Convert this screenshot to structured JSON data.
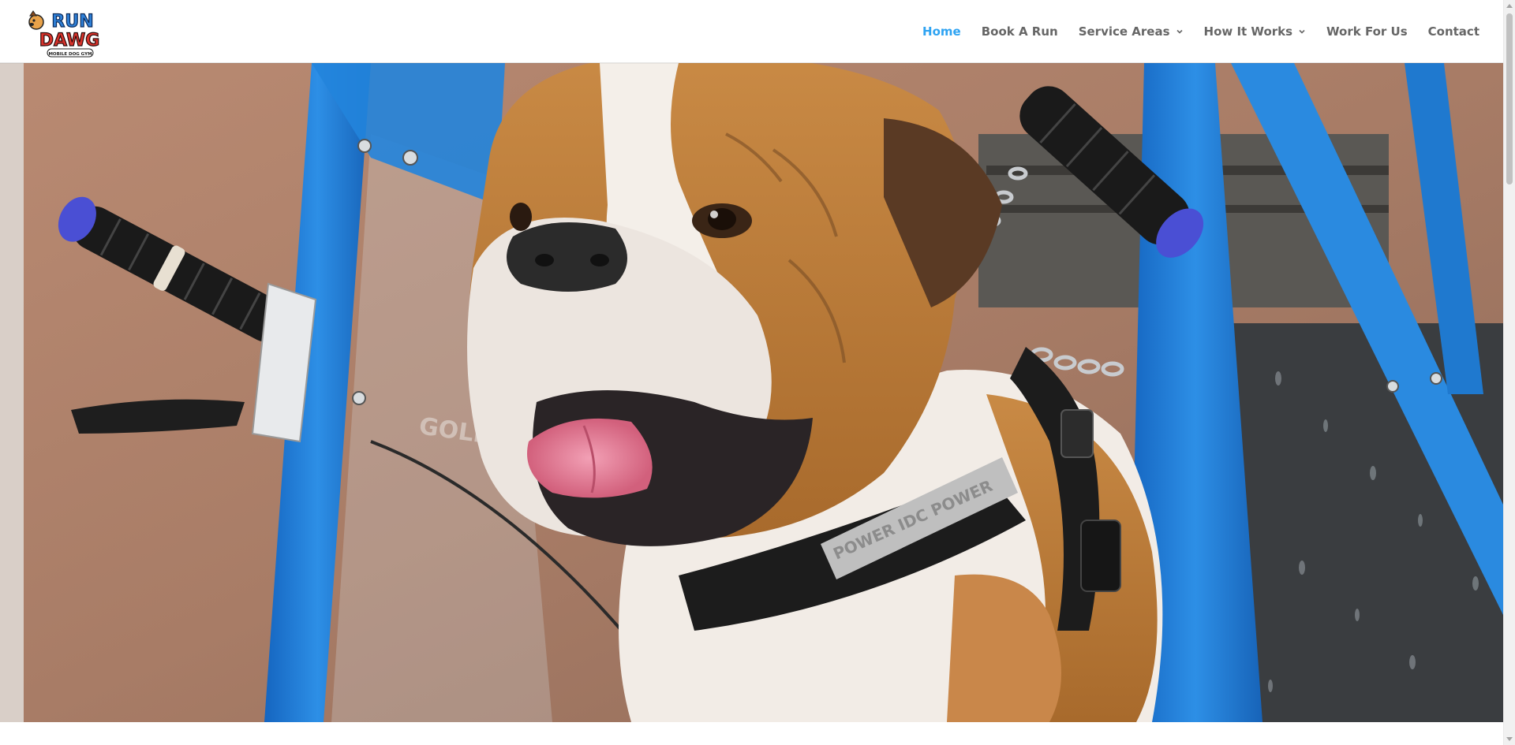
{
  "brand": {
    "logo_top": "RUN",
    "logo_bottom": "DAWG",
    "logo_tagline": "MOBILE DOG GYM"
  },
  "nav": {
    "items": [
      {
        "label": "Home",
        "active": true,
        "has_dropdown": false
      },
      {
        "label": "Book A Run",
        "active": false,
        "has_dropdown": false
      },
      {
        "label": "Service Areas",
        "active": false,
        "has_dropdown": true
      },
      {
        "label": "How It Works",
        "active": false,
        "has_dropdown": true
      },
      {
        "label": "Work For Us",
        "active": false,
        "has_dropdown": false
      },
      {
        "label": "Contact",
        "active": false,
        "has_dropdown": false
      }
    ]
  },
  "hero": {
    "harness_text": "POWER   IDC   POWER",
    "treadmill_text": "GOLIATHRUNNING"
  },
  "colors": {
    "accent": "#2ea3f2",
    "nav_text": "#666666",
    "frame_blue": "#1e88d8"
  }
}
